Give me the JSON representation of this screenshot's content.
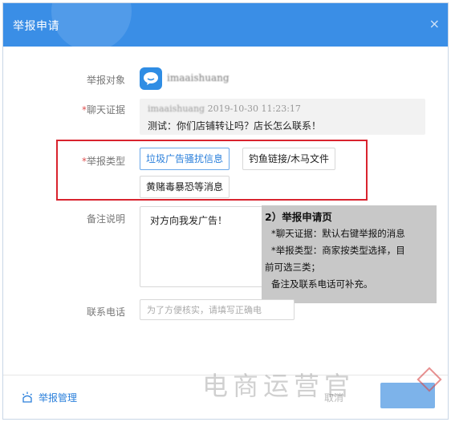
{
  "window": {
    "title": "举报申请",
    "close_glyph": "×"
  },
  "form": {
    "target_label": "举报对象",
    "target_username": "imaaishuang",
    "chat_label": "聊天证据",
    "chat_meta_name": "imaaishuang",
    "chat_meta_time": "2019-10-30 11:23:17",
    "chat_message": "测试：你们店铺转让吗？店长怎么联系！",
    "type_label": "举报类型",
    "type_options": [
      "垃圾广告骚扰信息",
      "钓鱼链接/木马文件",
      "黄赌毒暴恐等消息"
    ],
    "selected_type": "垃圾广告骚扰信息",
    "remarks_label": "备注说明",
    "remarks_value": "对方向我发广告！",
    "phone_label": "联系电话",
    "phone_placeholder": "为了方便核实，请填写正确电"
  },
  "annotation": {
    "heading": "2）举报申请页",
    "line1": "*聊天证据：默认右键举报的消息",
    "line2": "*举报类型：商家按类型选择，目",
    "line3": "前可选三类；",
    "line4": "备注及联系电话可补充。"
  },
  "footer": {
    "manage_label": "举报管理",
    "cancel_label": "取消"
  },
  "watermark": {
    "text": "电商运营官"
  },
  "colors": {
    "accent": "#3a8ee6",
    "highlight_border": "#d9232e",
    "link": "#2a7fdb"
  },
  "icons": {
    "avatar": "chat-bubble-icon",
    "manage": "report-icon",
    "close": "close-icon"
  }
}
